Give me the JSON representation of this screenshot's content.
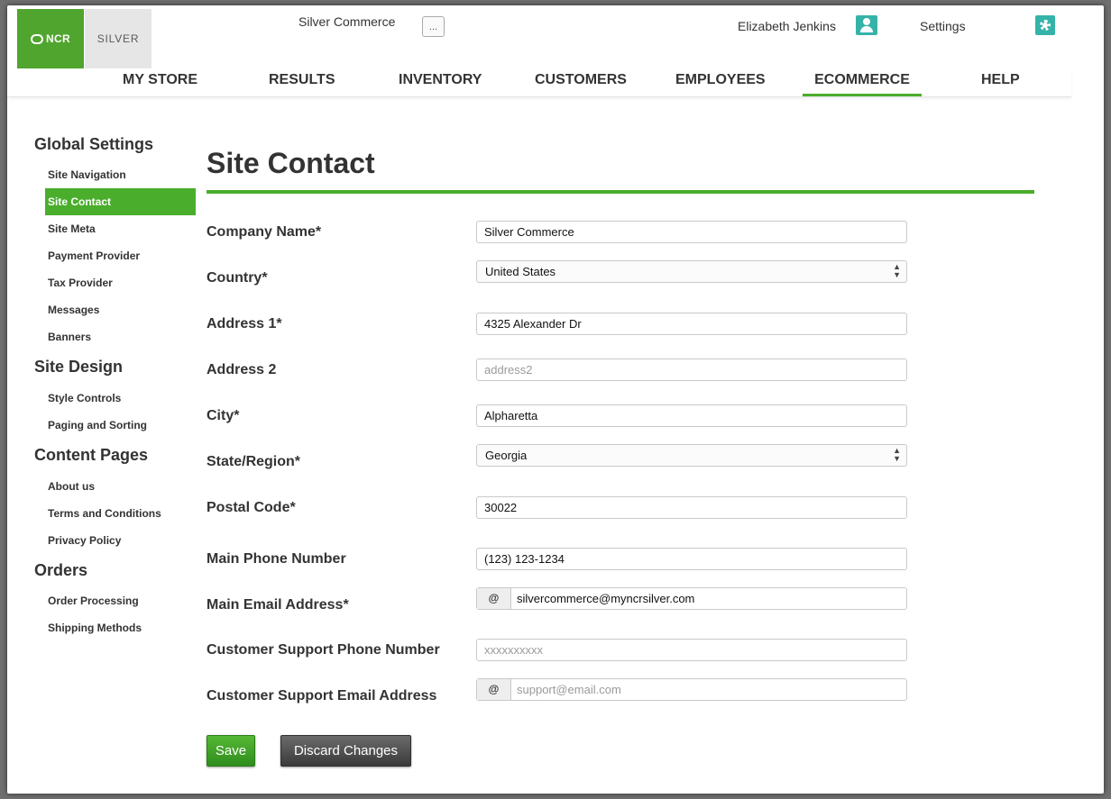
{
  "header": {
    "brand_ncr": "NCR",
    "brand_silver": "SILVER",
    "store_name": "Silver Commerce",
    "store_more": "...",
    "user_name": "Elizabeth Jenkins",
    "settings_label": "Settings"
  },
  "nav": {
    "items": [
      {
        "label": "MY STORE"
      },
      {
        "label": "RESULTS"
      },
      {
        "label": "INVENTORY"
      },
      {
        "label": "CUSTOMERS"
      },
      {
        "label": "EMPLOYEES"
      },
      {
        "label": "ECOMMERCE",
        "active": true
      },
      {
        "label": "HELP"
      }
    ]
  },
  "sidebar": {
    "sections": [
      {
        "title": "Global Settings",
        "items": [
          "Site Navigation",
          "Site Contact",
          "Site Meta",
          "Payment Provider",
          "Tax Provider",
          "Messages",
          "Banners"
        ]
      },
      {
        "title": "Site Design",
        "items": [
          "Style Controls",
          "Paging and Sorting"
        ]
      },
      {
        "title": "Content Pages",
        "items": [
          "About us",
          "Terms and Conditions",
          "Privacy Policy"
        ]
      },
      {
        "title": "Orders",
        "items": [
          "Order Processing",
          "Shipping Methods"
        ]
      }
    ],
    "active_item": "Site Contact"
  },
  "main": {
    "title": "Site Contact",
    "fields": {
      "company_name": {
        "label": "Company Name*",
        "value": "Silver Commerce"
      },
      "country": {
        "label": "Country*",
        "value": "United States"
      },
      "address1": {
        "label": "Address 1*",
        "value": "4325 Alexander Dr"
      },
      "address2": {
        "label": "Address 2",
        "placeholder": "address2"
      },
      "city": {
        "label": "City*",
        "value": "Alpharetta"
      },
      "state": {
        "label": "State/Region*",
        "value": "Georgia"
      },
      "postal": {
        "label": "Postal Code*",
        "value": "30022"
      },
      "main_phone": {
        "label": "Main Phone Number",
        "value": "(123) 123-1234"
      },
      "main_email": {
        "label": "Main Email Address*",
        "addon": "@",
        "value": "silvercommerce@myncrsilver.com"
      },
      "support_phone": {
        "label": "Customer Support Phone Number",
        "placeholder": "xxxxxxxxxx"
      },
      "support_email": {
        "label": "Customer Support Email Address",
        "addon": "@",
        "placeholder": "support@email.com"
      }
    },
    "buttons": {
      "save": "Save",
      "discard": "Discard Changes"
    }
  },
  "colors": {
    "accent": "#4aad2c",
    "teal_icon": "#35b3a8",
    "discard": "#4a4a4a"
  }
}
